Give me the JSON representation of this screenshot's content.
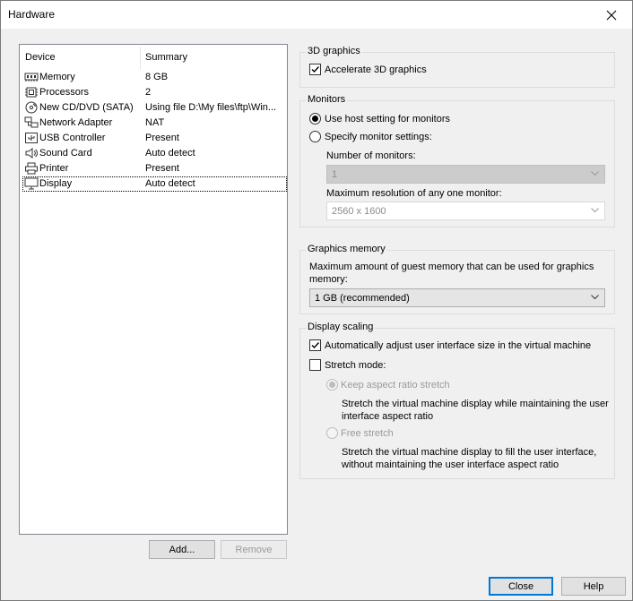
{
  "window": {
    "title": "Hardware"
  },
  "devices": {
    "header_device": "Device",
    "header_summary": "Summary",
    "items": [
      {
        "name": "Memory",
        "summary": "8 GB",
        "icon": "memory-icon"
      },
      {
        "name": "Processors",
        "summary": "2",
        "icon": "processor-icon"
      },
      {
        "name": "New CD/DVD (SATA)",
        "summary": "Using file D:\\My files\\ftp\\Win...",
        "icon": "cd-dvd-icon"
      },
      {
        "name": "Network Adapter",
        "summary": "NAT",
        "icon": "network-icon"
      },
      {
        "name": "USB Controller",
        "summary": "Present",
        "icon": "usb-icon"
      },
      {
        "name": "Sound Card",
        "summary": "Auto detect",
        "icon": "speaker-icon"
      },
      {
        "name": "Printer",
        "summary": "Present",
        "icon": "printer-icon"
      },
      {
        "name": "Display",
        "summary": "Auto detect",
        "icon": "monitor-icon"
      }
    ],
    "add_label": "Add...",
    "remove_label": "Remove"
  },
  "graphics3d": {
    "legend": "3D graphics",
    "accelerate_label": "Accelerate 3D graphics",
    "accelerate_checked": true
  },
  "monitors": {
    "legend": "Monitors",
    "use_host_label": "Use host setting for monitors",
    "specify_label": "Specify monitor settings:",
    "number_label": "Number of monitors:",
    "number_value": "1",
    "max_res_label": "Maximum resolution of any one monitor:",
    "max_res_value": "2560 x 1600"
  },
  "graphics_memory": {
    "legend": "Graphics memory",
    "desc_line1": "Maximum amount of guest memory that can be used for graphics",
    "desc_line2": "memory:",
    "value": "1 GB (recommended)"
  },
  "display_scaling": {
    "legend": "Display scaling",
    "auto_adjust_label": "Automatically adjust user interface size in the virtual machine",
    "auto_adjust_checked": true,
    "stretch_label": "Stretch mode:",
    "stretch_checked": false,
    "keep_aspect_label": "Keep aspect ratio stretch",
    "keep_aspect_desc1": "Stretch the virtual machine display while maintaining the user",
    "keep_aspect_desc2": "interface aspect ratio",
    "free_label": "Free stretch",
    "free_desc1": "Stretch the virtual machine display to fill the user interface,",
    "free_desc2": "without maintaining the user interface aspect ratio"
  },
  "footer": {
    "close_label": "Close",
    "help_label": "Help"
  }
}
